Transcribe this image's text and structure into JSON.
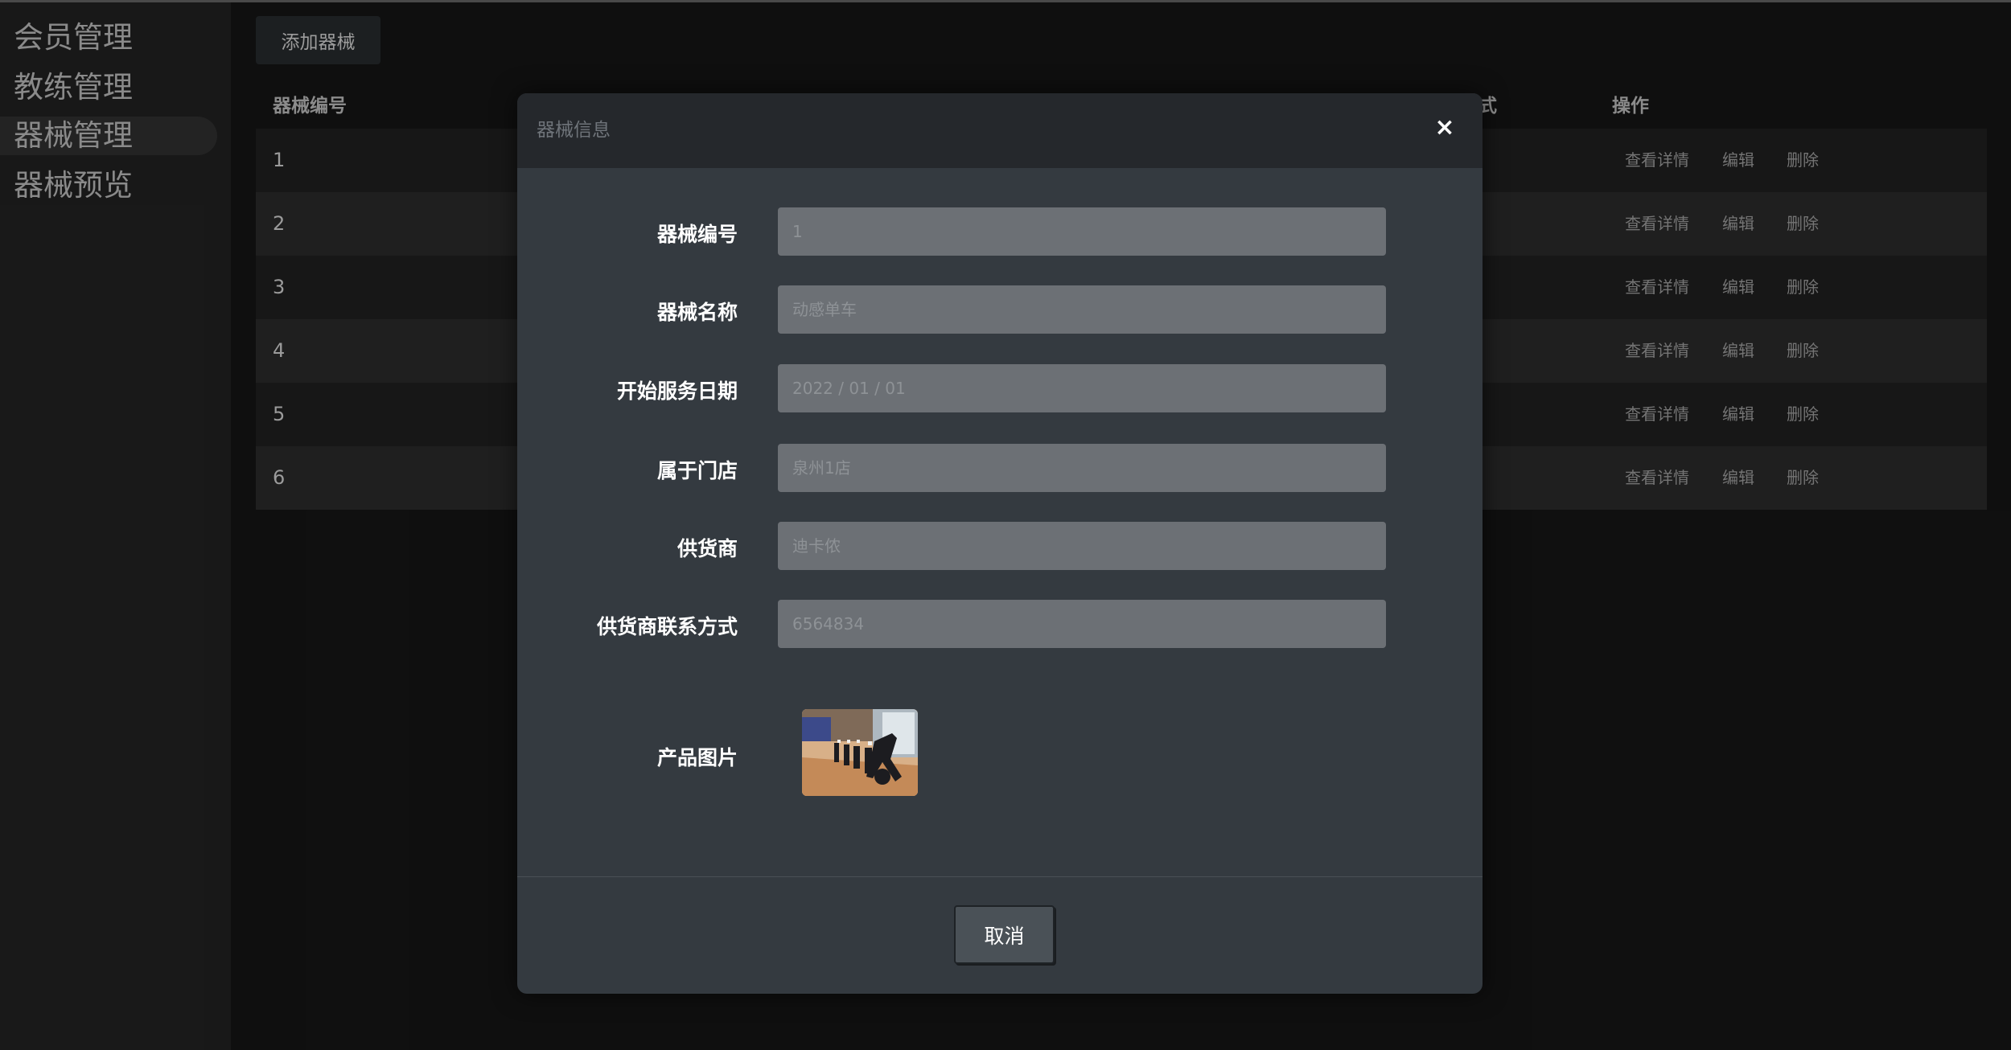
{
  "sidebar": {
    "items": [
      {
        "label": "会员管理"
      },
      {
        "label": "教练管理"
      },
      {
        "label": "器械管理"
      },
      {
        "label": "器械预览"
      }
    ]
  },
  "main": {
    "add_button": "添加器械",
    "table": {
      "headers": [
        "器械编号",
        "式",
        "操作"
      ],
      "rows": [
        {
          "id": "1",
          "actions": [
            "查看详情",
            "编辑",
            "删除"
          ]
        },
        {
          "id": "2",
          "actions": [
            "查看详情",
            "编辑",
            "删除"
          ]
        },
        {
          "id": "3",
          "actions": [
            "查看详情",
            "编辑",
            "删除"
          ]
        },
        {
          "id": "4",
          "actions": [
            "查看详情",
            "编辑",
            "删除"
          ]
        },
        {
          "id": "5",
          "actions": [
            "查看详情",
            "编辑",
            "删除"
          ]
        },
        {
          "id": "6",
          "actions": [
            "查看详情",
            "编辑",
            "删除"
          ]
        }
      ]
    }
  },
  "modal": {
    "title": "器械信息",
    "close_symbol": "×",
    "fields": [
      {
        "label": "器械编号",
        "value": "1"
      },
      {
        "label": "器械名称",
        "value": "动感单车"
      },
      {
        "label": "开始服务日期",
        "value": "2022 / 01 / 01"
      },
      {
        "label": "属于门店",
        "value": "泉州1店"
      },
      {
        "label": "供货商",
        "value": "迪卡侬"
      },
      {
        "label": "供货商联系方式",
        "value": "6564834"
      }
    ],
    "image_label": "产品图片",
    "cancel_button": "取消"
  },
  "colors": {
    "background": "#131313",
    "sidebar": "#1e1e1e",
    "modal": "#343a40",
    "modal_header": "#25282c",
    "field": "#6c7075"
  },
  "icons": {
    "close": "close-icon"
  }
}
